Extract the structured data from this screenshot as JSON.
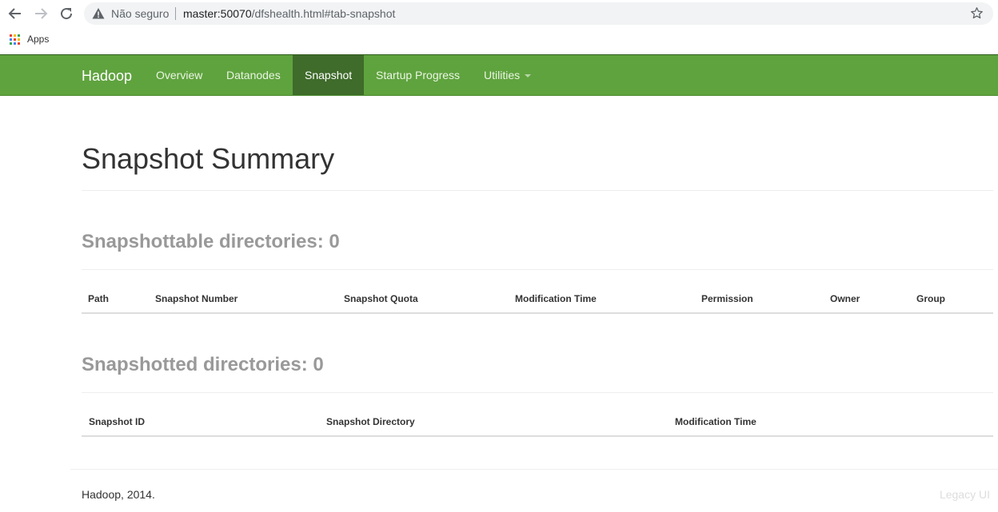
{
  "browser": {
    "security_label": "Não seguro",
    "url_host": "master:50070",
    "url_rest": "/dfshealth.html#tab-snapshot",
    "bookmarks": {
      "apps_label": "Apps"
    }
  },
  "navbar": {
    "brand": "Hadoop",
    "items": [
      {
        "label": "Overview",
        "active": false
      },
      {
        "label": "Datanodes",
        "active": false
      },
      {
        "label": "Snapshot",
        "active": true
      },
      {
        "label": "Startup Progress",
        "active": false
      },
      {
        "label": "Utilities",
        "active": false,
        "dropdown": true
      }
    ],
    "colors": {
      "background": "#5fa33e",
      "active": "#3f6b2b"
    }
  },
  "main": {
    "title": "Snapshot Summary",
    "snapshottable": {
      "heading": "Snapshottable directories: 0",
      "columns": [
        "Path",
        "Snapshot Number",
        "Snapshot Quota",
        "Modification Time",
        "Permission",
        "Owner",
        "Group"
      ]
    },
    "snapshotted": {
      "heading": "Snapshotted directories: 0",
      "columns": [
        "Snapshot ID",
        "Snapshot Directory",
        "Modification Time"
      ]
    }
  },
  "footer": {
    "left": "Hadoop, 2014.",
    "right": "Legacy UI"
  }
}
